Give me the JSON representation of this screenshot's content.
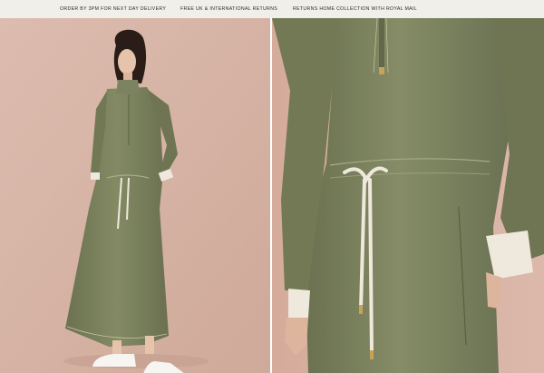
{
  "promo_bar": {
    "messages": [
      "ORDER BY 3PM FOR NEXT DAY DELIVERY",
      "FREE UK & INTERNATIONAL RETURNS",
      "RETURNS HOME COLLECTION WITH ROYAL MAIL"
    ]
  },
  "gallery": {
    "images": [
      {
        "alt_name": "model-full-length-photo"
      },
      {
        "alt_name": "dress-detail-closeup-photo"
      }
    ]
  },
  "colors": {
    "promo_background": "#f1efea",
    "backdrop": "#d9b6a8",
    "dress_olive": "#7d8360",
    "drawcord_cream": "#efe8dc"
  }
}
